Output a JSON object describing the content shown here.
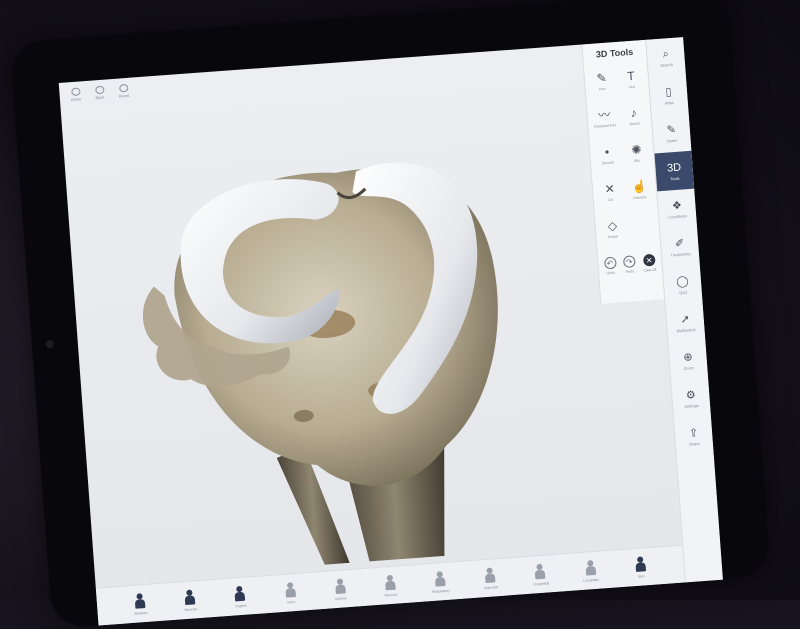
{
  "top_bar": {
    "buttons": [
      {
        "label": "Home",
        "icon": "home-icon"
      },
      {
        "label": "Back",
        "icon": "back-icon"
      },
      {
        "label": "Reset",
        "icon": "reset-icon"
      }
    ]
  },
  "tools_panel": {
    "title": "3D Tools",
    "tools": [
      {
        "label": "Pen",
        "icon": "pen-icon",
        "glyph": "✎"
      },
      {
        "label": "Text",
        "icon": "text-icon",
        "glyph": "T"
      },
      {
        "label": "Freehand Pen",
        "icon": "freehand-icon",
        "glyph": "〰"
      },
      {
        "label": "Sketch",
        "icon": "sketch-icon",
        "glyph": "♪"
      },
      {
        "label": "Smooth",
        "icon": "smooth-icon",
        "glyph": "•"
      },
      {
        "label": "Blur",
        "icon": "blur-icon",
        "glyph": "✺"
      },
      {
        "label": "Cut",
        "icon": "cut-icon",
        "glyph": "✕"
      },
      {
        "label": "Dissolve",
        "icon": "dissolve-icon",
        "glyph": "☝"
      },
      {
        "label": "Eraser",
        "icon": "eraser-icon",
        "glyph": "◇"
      }
    ],
    "actions": [
      {
        "label": "Undo",
        "icon": "undo-icon",
        "glyph": "↶"
      },
      {
        "label": "Redo",
        "icon": "redo-icon",
        "glyph": "↷"
      },
      {
        "label": "Clear All",
        "icon": "clear-all-icon",
        "glyph": "✕"
      }
    ]
  },
  "sidebar": {
    "items": [
      {
        "label": "Search",
        "icon": "search-icon",
        "glyph": "⌕"
      },
      {
        "label": "Atlas",
        "icon": "book-icon",
        "glyph": "▯"
      },
      {
        "label": "Notes",
        "icon": "pen-icon",
        "glyph": "✎"
      },
      {
        "label": "Tools",
        "icon": "3d-icon",
        "glyph": "3D",
        "active": true
      },
      {
        "label": "Conditions",
        "icon": "conditions-icon",
        "glyph": "❖"
      },
      {
        "label": "Treatments",
        "icon": "treatments-icon",
        "glyph": "✐"
      },
      {
        "label": "Quiz",
        "icon": "quiz-icon",
        "glyph": "◯"
      },
      {
        "label": "Multiselect",
        "icon": "pointer-icon",
        "glyph": "➚"
      },
      {
        "label": "Zoom",
        "icon": "zoom-icon",
        "glyph": "⊕"
      },
      {
        "label": "Settings",
        "icon": "gear-icon",
        "glyph": "⚙"
      },
      {
        "label": "Share",
        "icon": "share-icon",
        "glyph": "⇪"
      }
    ]
  },
  "bottom_bar": {
    "layers": [
      {
        "label": "Skeleton",
        "on": true
      },
      {
        "label": "Muscles",
        "on": true
      },
      {
        "label": "Organs",
        "on": true
      },
      {
        "label": "Veins",
        "on": false
      },
      {
        "label": "Arteries",
        "on": false
      },
      {
        "label": "Nervous",
        "on": false
      },
      {
        "label": "Respiratory",
        "on": false
      },
      {
        "label": "Digestive",
        "on": false
      },
      {
        "label": "Urogenital",
        "on": false
      },
      {
        "label": "Lymphatic",
        "on": false
      },
      {
        "label": "Skin",
        "on": true
      }
    ]
  }
}
